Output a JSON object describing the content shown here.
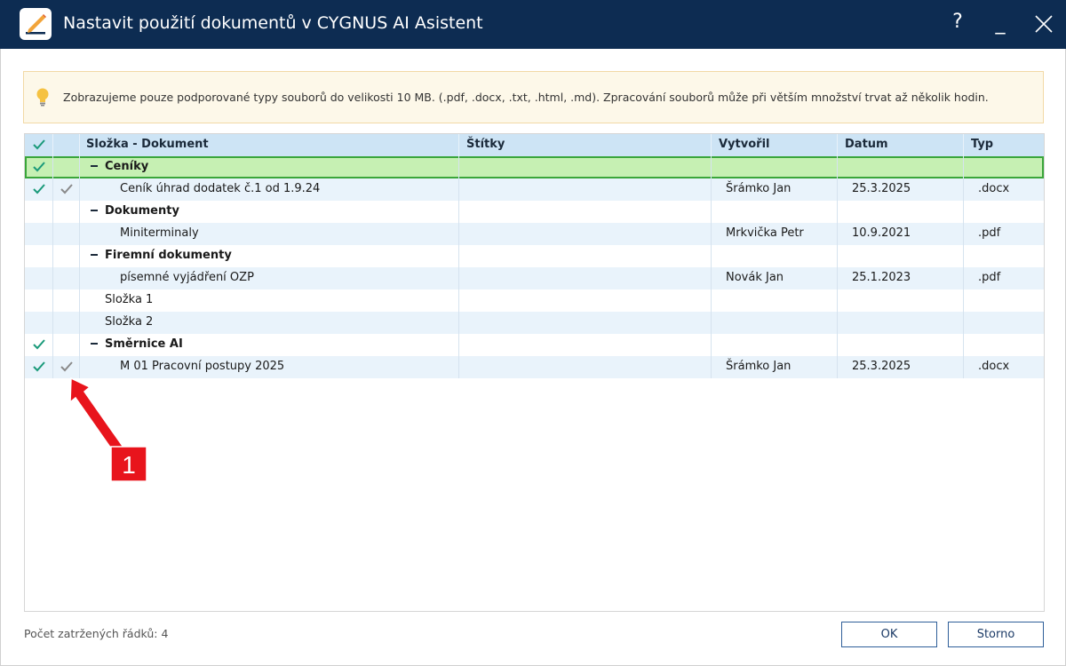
{
  "window": {
    "title": "Nastavit použití dokumentů v CYGNUS AI Asistent",
    "help_label": "?",
    "minimize_label": "_",
    "close_label": "✕"
  },
  "info": {
    "text": "Zobrazujeme pouze podporované typy souborů do velikosti 10 MB. (.pdf, .docx, .txt, .html, .md). Zpracování souborů může při větším množství trvat až několik hodin."
  },
  "grid": {
    "columns": {
      "doc": "Složka - Dokument",
      "tags": "Štítky",
      "author": "Vytvořil",
      "date": "Datum",
      "type": "Typ"
    },
    "rows": [
      {
        "name": "Ceníky",
        "tags": "",
        "author": "",
        "date": "",
        "type": ""
      },
      {
        "name": "Ceník úhrad dodatek č.1 od 1.9.24",
        "tags": "",
        "author": "Šrámko Jan",
        "date": "25.3.2025",
        "type": ".docx"
      },
      {
        "name": "Dokumenty",
        "tags": "",
        "author": "",
        "date": "",
        "type": ""
      },
      {
        "name": "Miniterminaly",
        "tags": "",
        "author": "Mrkvička Petr",
        "date": "10.9.2021",
        "type": ".pdf"
      },
      {
        "name": "Firemní dokumenty",
        "tags": "",
        "author": "",
        "date": "",
        "type": ""
      },
      {
        "name": "písemné vyjádření OZP",
        "tags": "",
        "author": "Novák Jan",
        "date": "25.1.2023",
        "type": ".pdf"
      },
      {
        "name": "Složka 1",
        "tags": "",
        "author": "",
        "date": "",
        "type": ""
      },
      {
        "name": "Složka 2",
        "tags": "",
        "author": "",
        "date": "",
        "type": ""
      },
      {
        "name": "Směrnice AI",
        "tags": "",
        "author": "",
        "date": "",
        "type": ""
      },
      {
        "name": "M 01 Pracovní postupy 2025",
        "tags": "",
        "author": "Šrámko Jan",
        "date": "25.3.2025",
        "type": ".docx"
      }
    ]
  },
  "footer": {
    "count_text": "Počet zatržených řádků: 4",
    "ok_label": "OK",
    "cancel_label": "Storno"
  },
  "callout": {
    "number": "1"
  },
  "colors": {
    "titlebar": "#0d2c52",
    "check_green": "#1a9a7a",
    "check_gray": "#8a8a8a",
    "selected_row": "#c6f0b3",
    "callout_red": "#e8141c"
  }
}
